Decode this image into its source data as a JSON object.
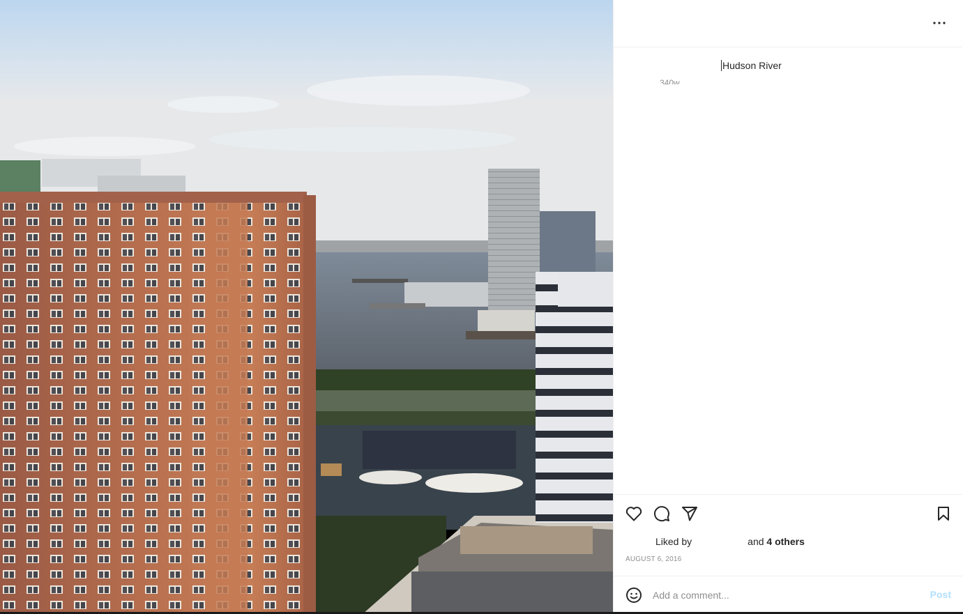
{
  "post": {
    "caption": "Hudson River",
    "time_ago": "340w",
    "liked_by_prefix": "Liked by",
    "liked_by_middle": "and",
    "liked_by_others": "4 others",
    "date": "AUGUST 6, 2016"
  },
  "comment": {
    "placeholder": "Add a comment...",
    "post_label": "Post"
  },
  "icons": {
    "more": "more-options-icon",
    "like": "heart-icon",
    "comment": "comment-bubble-icon",
    "share": "paper-plane-icon",
    "save": "bookmark-icon",
    "emoji": "smiley-icon"
  },
  "colors": {
    "text": "#262626",
    "muted": "#8e8e8e",
    "post_button_disabled": "#b2dffc",
    "divider": "#efefef"
  }
}
